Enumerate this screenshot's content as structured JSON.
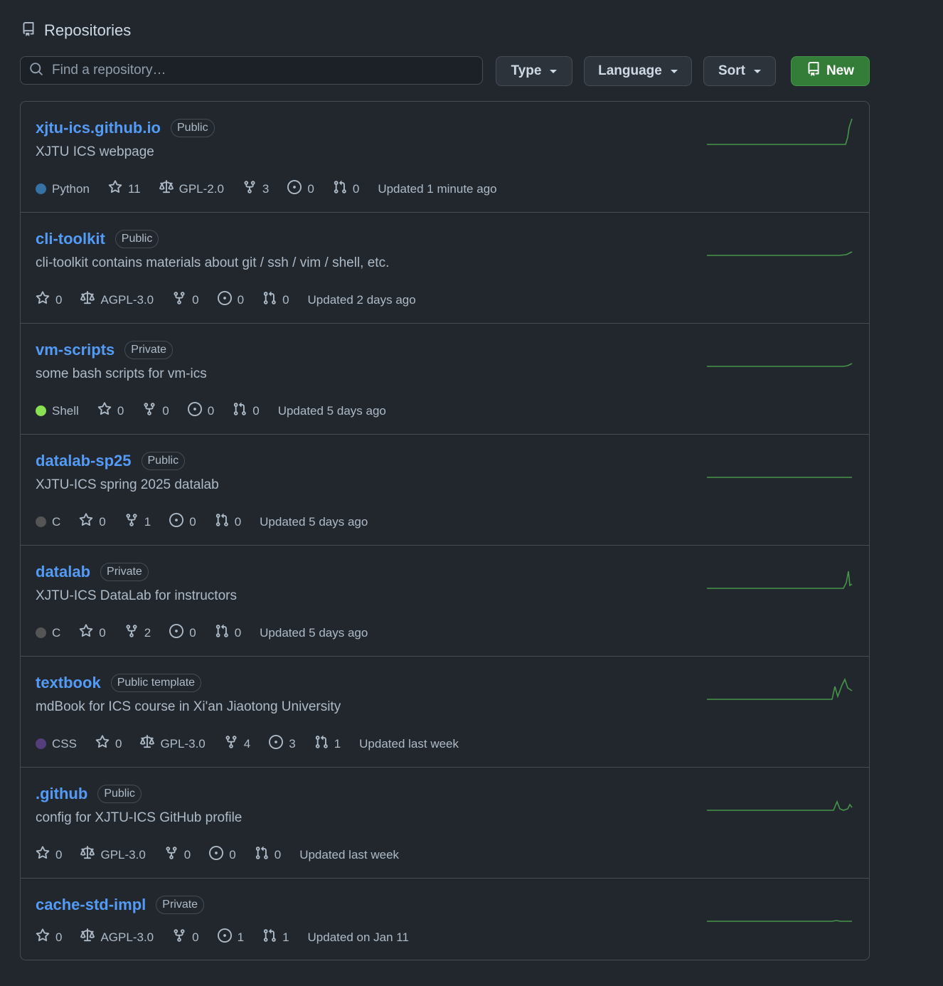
{
  "header": {
    "title": "Repositories"
  },
  "search": {
    "placeholder": "Find a repository…"
  },
  "filters": {
    "type": "Type",
    "language": "Language",
    "sort": "Sort",
    "new": "New"
  },
  "colors": {
    "python": "#3572A5",
    "shell": "#89e051",
    "c": "#555555",
    "css": "#563d7c",
    "link": "#539bf5",
    "spark": "#46954a"
  },
  "repos": [
    {
      "name": "xjtu-ics.github.io",
      "visibility": "Public",
      "description": "XJTU ICS webpage",
      "language": "Python",
      "stars": "11",
      "license": "GPL-2.0",
      "forks": "3",
      "issues": "0",
      "prs": "0",
      "updated": "Updated 1 minute ago"
    },
    {
      "name": "cli-toolkit",
      "visibility": "Public",
      "description": "cli-toolkit contains materials about git / ssh / vim / shell, etc.",
      "stars": "0",
      "license": "AGPL-3.0",
      "forks": "0",
      "issues": "0",
      "prs": "0",
      "updated": "Updated 2 days ago"
    },
    {
      "name": "vm-scripts",
      "visibility": "Private",
      "description": "some bash scripts for vm-ics",
      "language": "Shell",
      "stars": "0",
      "forks": "0",
      "issues": "0",
      "prs": "0",
      "updated": "Updated 5 days ago"
    },
    {
      "name": "datalab-sp25",
      "visibility": "Public",
      "description": "XJTU-ICS spring 2025 datalab",
      "language": "C",
      "stars": "0",
      "forks": "1",
      "issues": "0",
      "prs": "0",
      "updated": "Updated 5 days ago"
    },
    {
      "name": "datalab",
      "visibility": "Private",
      "description": "XJTU-ICS DataLab for instructors",
      "language": "C",
      "stars": "0",
      "forks": "2",
      "issues": "0",
      "prs": "0",
      "updated": "Updated 5 days ago"
    },
    {
      "name": "textbook",
      "visibility": "Public template",
      "description": "mdBook for ICS course in Xi'an Jiaotong University",
      "language": "CSS",
      "stars": "0",
      "license": "GPL-3.0",
      "forks": "4",
      "issues": "3",
      "prs": "1",
      "updated": "Updated last week"
    },
    {
      "name": ".github",
      "visibility": "Public",
      "description": "config for XJTU-ICS GitHub profile",
      "stars": "0",
      "license": "GPL-3.0",
      "forks": "0",
      "issues": "0",
      "prs": "0",
      "updated": "Updated last week"
    },
    {
      "name": "cache-std-impl",
      "visibility": "Private",
      "description": "",
      "stars": "0",
      "license": "AGPL-3.0",
      "forks": "0",
      "issues": "1",
      "prs": "1",
      "updated": "Updated on Jan 11"
    }
  ]
}
